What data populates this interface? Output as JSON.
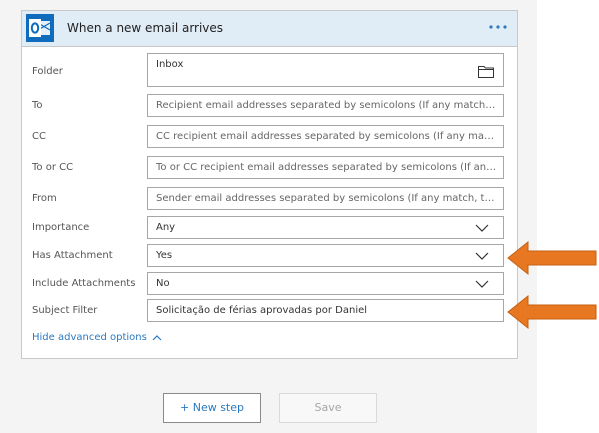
{
  "trigger": {
    "title": "When a new email arrives",
    "icon": "outlook-icon",
    "more_label": "•••",
    "accent_color": "#0f6cbd"
  },
  "fields": [
    {
      "label": "Folder",
      "value": "Inbox",
      "placeholder": ""
    },
    {
      "label": "To",
      "value": "",
      "placeholder": "Recipient email addresses separated by semicolons (If any match, the trigger will run)"
    },
    {
      "label": "CC",
      "value": "",
      "placeholder": "CC recipient email addresses separated by semicolons (If any match, the trigger will run)"
    },
    {
      "label": "To or CC",
      "value": "",
      "placeholder": "To or CC recipient email addresses separated by semicolons (If any match, the trigger will run)"
    },
    {
      "label": "From",
      "value": "",
      "placeholder": "Sender email addresses separated by semicolons (If any match, the trigger will run)"
    },
    {
      "label": "Importance",
      "value": "Any"
    },
    {
      "label": "Has Attachment",
      "value": "Yes"
    },
    {
      "label": "Include Attachments",
      "value": "No"
    },
    {
      "label": "Subject Filter",
      "value": "Solicitação de férias aprovadas por Daniel"
    }
  ],
  "advanced_link": "Hide advanced options",
  "buttons": {
    "new_step": "+ New step",
    "save": "Save"
  },
  "annotation_color": "#e87722"
}
